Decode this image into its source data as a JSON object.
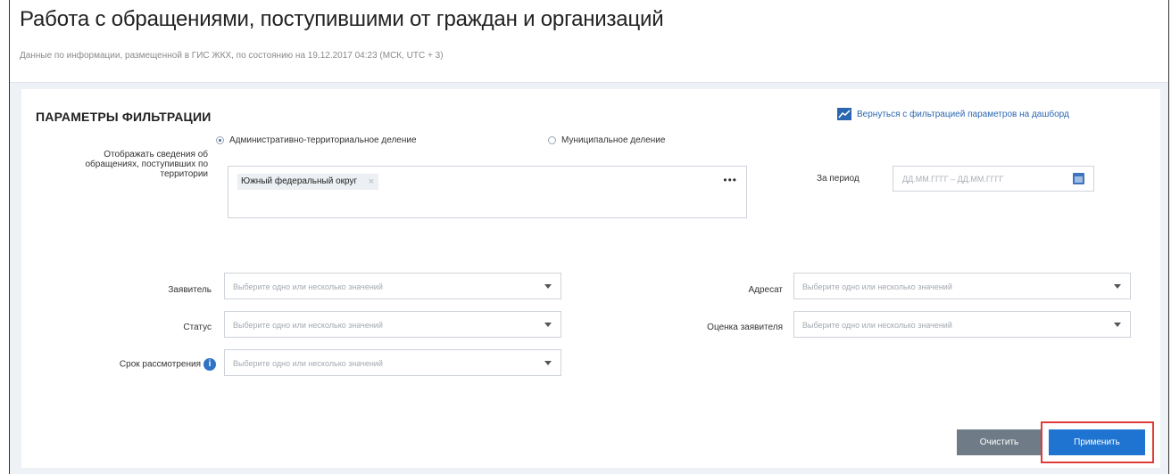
{
  "header": {
    "title": "Работа с обращениями, поступившими от граждан и организаций",
    "subtitle": "Данные по информации, размещенной в ГИС ЖКХ, по состоянию на 19.12.2017 04:23 (МСК, UTC + 3)"
  },
  "filters": {
    "heading": "ПАРАМЕТРЫ ФИЛЬТРАЦИИ",
    "dashboard_link": "Вернуться с фильтрацией параметров на дашборд",
    "division": {
      "options": [
        {
          "label": "Административно-территориальное деление",
          "selected": true
        },
        {
          "label": "Муниципальное деление",
          "selected": false
        }
      ]
    },
    "territory": {
      "label": "Отображать сведения об обращениях, поступивших по территории",
      "chip": "Южный федеральный округ",
      "more": "•••"
    },
    "period": {
      "label": "За период",
      "placeholder": "ДД.ММ.ГГГГ – ДД.ММ.ГГГГ"
    },
    "applicant": {
      "label": "Заявитель",
      "placeholder": "Выберите одно или несколько значений"
    },
    "addressee": {
      "label": "Адресат",
      "placeholder": "Выберите одно или несколько значений"
    },
    "status": {
      "label": "Статус",
      "placeholder": "Выберите одно или несколько значений"
    },
    "rating": {
      "label": "Оценка заявителя",
      "placeholder": "Выберите одно или несколько значений"
    },
    "term": {
      "label": "Срок рассмотрения",
      "placeholder": "Выберите одно или несколько значений",
      "info": "i"
    }
  },
  "actions": {
    "clear_label": "Очистить",
    "apply_label": "Применить"
  },
  "colors": {
    "accent": "#1f74d1",
    "highlight": "#e03a3a",
    "secondary_button": "#6f7c87"
  }
}
